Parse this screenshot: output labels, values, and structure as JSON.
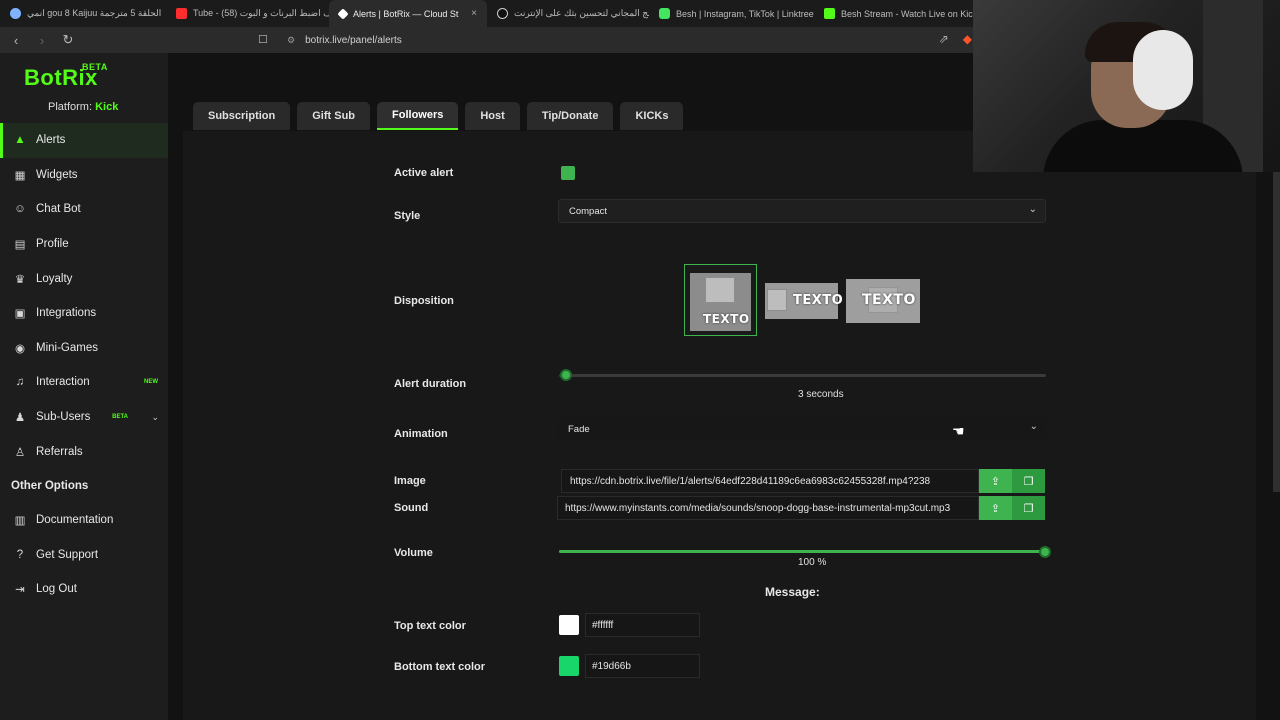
{
  "browser": {
    "tabs": [
      {
        "label": "انمي gou 8 Kaijuu الحلقة 5 مترجمة",
        "color": "#7fb3ff"
      },
      {
        "label": "Tube - كيف اضبط البرنات و البوت (58)",
        "color": "#ff2d2d"
      },
      {
        "label": "Alerts | BotRix — Cloud Streamin",
        "color": "#ffffff"
      },
      {
        "label": "البرنامج المجاني لتحسين بثك على الإنترنت",
        "color": "#e0e0e0"
      },
      {
        "label": "Besh | Instagram, TikTok | Linktree",
        "color": "#43e660"
      },
      {
        "label": "Besh Stream - Watch Live on Kick",
        "color": "#53fc18"
      }
    ],
    "close_glyph": "×",
    "url": "botrix.live/panel/alerts",
    "icons": {
      "back": "‹",
      "forward": "›",
      "reload": "↻",
      "bookmark": "☐",
      "share": "⇗",
      "shield": "◆"
    }
  },
  "sidebar": {
    "logo": "BotRix",
    "logo_badge": "BETA",
    "platform_label": "Platform:",
    "platform_value": "Kick",
    "items": [
      {
        "label": "Alerts",
        "icon": "warning-icon",
        "glyph": "▲"
      },
      {
        "label": "Widgets",
        "icon": "grid-icon",
        "glyph": "▦"
      },
      {
        "label": "Chat Bot",
        "icon": "robot-icon",
        "glyph": "☺"
      },
      {
        "label": "Profile",
        "icon": "id-card-icon",
        "glyph": "▤"
      },
      {
        "label": "Loyalty",
        "icon": "trophy-icon",
        "glyph": "♛"
      },
      {
        "label": "Integrations",
        "icon": "plug-icon",
        "glyph": "▣"
      },
      {
        "label": "Mini-Games",
        "icon": "gamepad-icon",
        "glyph": "◉"
      },
      {
        "label": "Interaction",
        "icon": "music-icon",
        "glyph": "♫",
        "badge": "NEW"
      },
      {
        "label": "Sub-Users",
        "icon": "users-icon",
        "glyph": "♟",
        "badge": "BETA",
        "chevron": "⌄"
      },
      {
        "label": "Referrals",
        "icon": "user-friends-icon",
        "glyph": "♙"
      }
    ],
    "other_title": "Other Options",
    "other_items": [
      {
        "label": "Documentation",
        "icon": "book-icon",
        "glyph": "▥"
      },
      {
        "label": "Get Support",
        "icon": "question-icon",
        "glyph": "?"
      },
      {
        "label": "Log Out",
        "icon": "logout-icon",
        "glyph": "⇥"
      }
    ]
  },
  "panel_tabs": [
    "Subscription",
    "Gift Sub",
    "Followers",
    "Host",
    "Tip/Donate",
    "KICKs"
  ],
  "active_tab": "Followers",
  "form": {
    "active_alert_label": "Active alert",
    "active_alert_checked": true,
    "style_label": "Style",
    "style_value": "Compact",
    "disposition_label": "Disposition",
    "disposition_text": "TEXTO",
    "alert_duration_label": "Alert duration",
    "alert_duration_value": "3",
    "alert_duration_unit": "seconds",
    "alert_duration_fraction": 0.0,
    "animation_label": "Animation",
    "animation_value": "Fade",
    "image_label": "Image",
    "image_value": "https://cdn.botrix.live/file/1/alerts/64edf228d41189c6ea6983c62455328f.mp4?238",
    "sound_label": "Sound",
    "sound_value": "https://www.myinstants.com/media/sounds/snoop-dogg-base-instrumental-mp3cut.mp3",
    "volume_label": "Volume",
    "volume_value": "100",
    "volume_unit": "%",
    "volume_fraction": 1.0,
    "message_title": "Message:",
    "top_text_color_label": "Top text color",
    "top_text_color": "#ffffff",
    "bottom_text_color_label": "Bottom text color",
    "bottom_text_color": "#19d66b",
    "upload_glyph": "⇪",
    "gallery_glyph": "❐"
  },
  "colors": {
    "accent": "#53fc18",
    "button": "#3eb34f"
  }
}
